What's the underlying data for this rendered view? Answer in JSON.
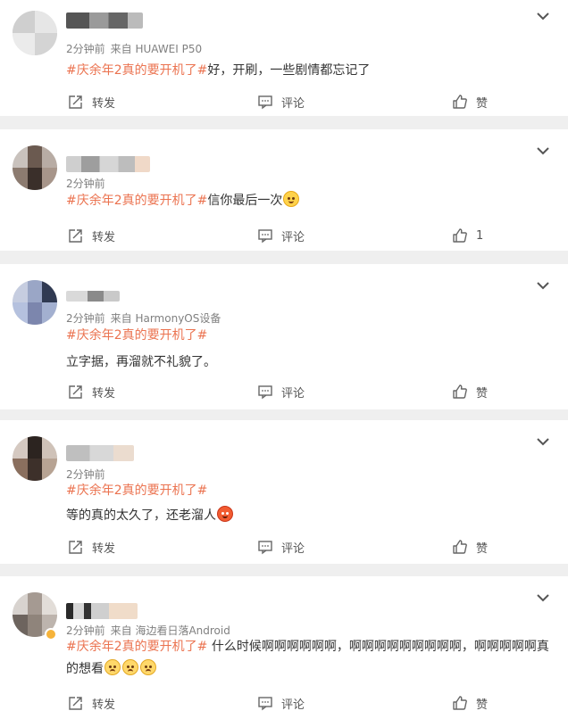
{
  "posts": [
    {
      "time": "2分钟前",
      "source": "来自 HUAWEI P50",
      "topic": "#庆余年2真的要开机了#",
      "text": "好，开刷，一些剧情都忘记了",
      "emojis": [],
      "forward_label": "转发",
      "comment_label": "评论",
      "like_label": "赞"
    },
    {
      "time": "2分钟前",
      "source": "",
      "topic": "#庆余年2真的要开机了#",
      "text": "信你最后一次",
      "emojis": [
        "smile-emoji"
      ],
      "forward_label": "转发",
      "comment_label": "评论",
      "like_label": "1"
    },
    {
      "time": "2分钟前",
      "source": "来自 HarmonyOS设备",
      "topic": "#庆余年2真的要开机了#",
      "text": "立字据，再溜就不礼貌了。",
      "emojis": [],
      "forward_label": "转发",
      "comment_label": "评论",
      "like_label": "赞"
    },
    {
      "time": "2分钟前",
      "source": "",
      "topic": "#庆余年2真的要开机了#",
      "text": "等的真的太久了，还老溜人",
      "emojis": [
        "angry-emoji"
      ],
      "forward_label": "转发",
      "comment_label": "评论",
      "like_label": "赞"
    },
    {
      "time": "2分钟前",
      "source": "来自 海边看日落Android",
      "topic": "#庆余年2真的要开机了#",
      "text": " 什么时候啊啊啊啊啊啊，啊啊啊啊啊啊啊啊啊，啊啊啊啊啊真的想看",
      "emojis": [
        "sad-emoji",
        "sad-emoji",
        "sad-emoji"
      ],
      "forward_label": "转发",
      "comment_label": "评论",
      "like_label": "赞"
    }
  ],
  "colors": {
    "topic": "#eb7350",
    "meta": "#808080",
    "background": "#efefef"
  }
}
